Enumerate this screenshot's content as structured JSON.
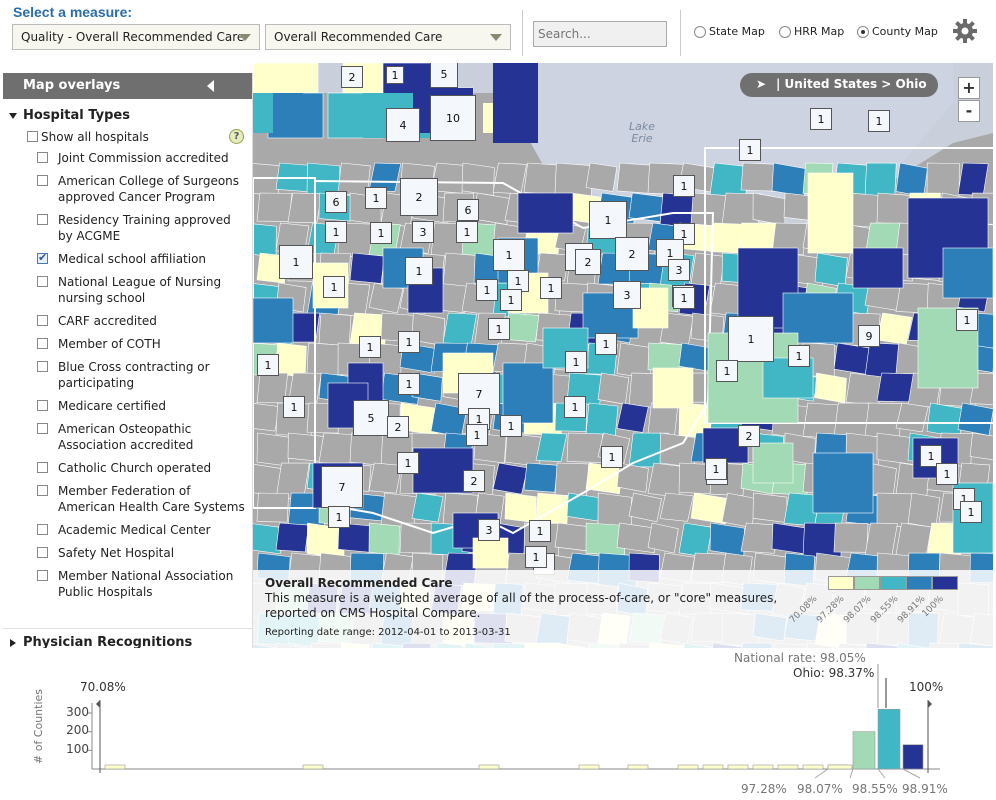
{
  "header": {
    "select_title": "Select a measure:",
    "measure_category": "Quality - Overall Recommended Care",
    "measure_name": "Overall Recommended Care",
    "search_placeholder": "Search...",
    "map_types": [
      {
        "label": "State Map",
        "selected": false
      },
      {
        "label": "HRR Map",
        "selected": false
      },
      {
        "label": "County Map",
        "selected": true
      }
    ]
  },
  "sidebar": {
    "title": "Map overlays",
    "hospital_types_label": "Hospital Types",
    "show_all_label": "Show all hospitals",
    "help_glyph": "?",
    "items": [
      {
        "label": "Joint Commission accredited",
        "checked": false
      },
      {
        "label": "American College of Surgeons approved Cancer Program",
        "checked": false
      },
      {
        "label": "Residency Training approved by ACGME",
        "checked": false
      },
      {
        "label": "Medical school affiliation",
        "checked": true
      },
      {
        "label": "National League of Nursing nursing school",
        "checked": false
      },
      {
        "label": "CARF accredited",
        "checked": false
      },
      {
        "label": "Member of COTH",
        "checked": false
      },
      {
        "label": "Blue Cross contracting or participating",
        "checked": false
      },
      {
        "label": "Medicare certified",
        "checked": false
      },
      {
        "label": "American Osteopathic Association accredited",
        "checked": false
      },
      {
        "label": "Catholic Church operated",
        "checked": false
      },
      {
        "label": "Member Federation of American Health Care Systems",
        "checked": false
      },
      {
        "label": "Academic Medical Center",
        "checked": false
      },
      {
        "label": "Safety Net Hospital",
        "checked": false
      },
      {
        "label": "Member National Association Public Hospitals",
        "checked": false
      }
    ],
    "physician_label": "Physician Recognitions"
  },
  "map": {
    "breadcrumb": "| United States > Ohio",
    "zoom_in": "+",
    "zoom_out": "-",
    "lake_label": "Lake Erie",
    "hospital_counts": [
      "2",
      "1",
      "5",
      "10",
      "4",
      "1",
      "1",
      "1",
      "1",
      "6",
      "1",
      "2",
      "6",
      "1",
      "1",
      "1",
      "1",
      "3",
      "1",
      "1",
      "2",
      "1",
      "3",
      "2",
      "3",
      "1",
      "1",
      "1",
      "1",
      "1",
      "2",
      "1",
      "3",
      "1",
      "1",
      "1",
      "1",
      "1",
      "1",
      "1",
      "9",
      "1",
      "1",
      "1",
      "1",
      "1",
      "7",
      "1",
      "1",
      "5",
      "2",
      "1",
      "1",
      "1",
      "1",
      "1",
      "1",
      "7",
      "1",
      "2",
      "1",
      "2",
      "1",
      "1",
      "1",
      "1",
      "1",
      "1",
      "3",
      "2",
      "1"
    ]
  },
  "legend": {
    "title": "Overall Recommended Care",
    "description": "This measure is a weighted average of all of the process-of-care, or \"core\" measures, reported on CMS Hospital Compare.",
    "date_range": "Reporting date range: 2012-04-01 to 2013-03-31",
    "colors": [
      "#ffffcc",
      "#a1dab4",
      "#41b6c4",
      "#2c7fb8",
      "#253494"
    ],
    "ticks": [
      "70.08%",
      "97.28%",
      "98.07%",
      "98.55%",
      "98.91%",
      "100%"
    ]
  },
  "histogram": {
    "y_axis_label": "# of Counties",
    "y_ticks": [
      "100",
      "200",
      "300"
    ],
    "min_label": "70.08%",
    "max_label": "100%",
    "national_label": "National rate: 98.05%",
    "state_label": "Ohio: 98.37%",
    "bottom_labels": [
      "97.28%",
      "98.07%",
      "98.55%",
      "98.91%"
    ]
  },
  "chart_data": {
    "type": "bar",
    "title": "",
    "xlabel": "",
    "ylabel": "# of Counties",
    "x_range": [
      "70.08%",
      "100%"
    ],
    "ylim": [
      0,
      350
    ],
    "bins": [
      {
        "x": "70.1%",
        "count": 1,
        "color": "#ffffcc"
      },
      {
        "x": "77%",
        "count": 1,
        "color": "#ffffcc"
      },
      {
        "x": "85%",
        "count": 1,
        "color": "#ffffcc"
      },
      {
        "x": "89%",
        "count": 1,
        "color": "#ffffcc"
      },
      {
        "x": "91%",
        "count": 1,
        "color": "#ffffcc"
      },
      {
        "x": "93%",
        "count": 1,
        "color": "#ffffcc"
      },
      {
        "x": "94%",
        "count": 1,
        "color": "#ffffcc"
      },
      {
        "x": "94.5%",
        "count": 1,
        "color": "#ffffcc"
      },
      {
        "x": "95%",
        "count": 1,
        "color": "#ffffcc"
      },
      {
        "x": "95.5%",
        "count": 1,
        "color": "#ffffcc"
      },
      {
        "x": "96%",
        "count": 2,
        "color": "#ffffcc"
      },
      {
        "x": "96.5%",
        "count": 3,
        "color": "#ffffcc"
      },
      {
        "x": "97%",
        "count": 7,
        "color": "#ffffcc"
      },
      {
        "x": "97.3%",
        "count": 20,
        "color": "#ffffcc"
      },
      {
        "x": "97.8%",
        "count": 200,
        "color": "#a1dab4"
      },
      {
        "x": "98.3%",
        "count": 320,
        "color": "#41b6c4"
      },
      {
        "x": "98.8%",
        "count": 130,
        "color": "#253494"
      }
    ],
    "markers": [
      {
        "label": "National rate",
        "value": 98.05
      },
      {
        "label": "Ohio",
        "value": 98.37
      }
    ]
  }
}
